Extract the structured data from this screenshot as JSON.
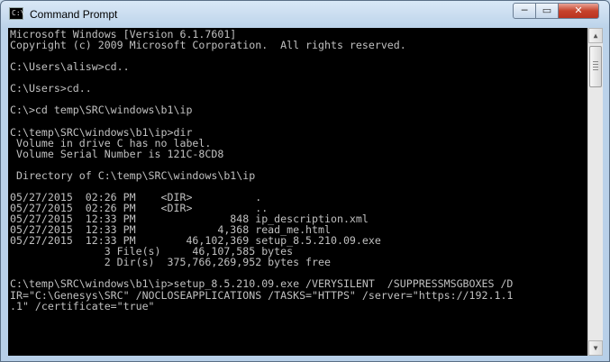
{
  "window": {
    "title": "Command Prompt",
    "app_icon_glyph": "C:\\",
    "controls": {
      "minimize": "─",
      "maximize": "▭",
      "close": "✕"
    }
  },
  "console": {
    "lines": [
      "Microsoft Windows [Version 6.1.7601]",
      "Copyright (c) 2009 Microsoft Corporation.  All rights reserved.",
      "",
      "C:\\Users\\alisw>cd..",
      "",
      "C:\\Users>cd..",
      "",
      "C:\\>cd temp\\SRC\\windows\\b1\\ip",
      "",
      "C:\\temp\\SRC\\windows\\b1\\ip>dir",
      " Volume in drive C has no label.",
      " Volume Serial Number is 121C-8CD8",
      "",
      " Directory of C:\\temp\\SRC\\windows\\b1\\ip",
      "",
      "05/27/2015  02:26 PM    <DIR>          .",
      "05/27/2015  02:26 PM    <DIR>          ..",
      "05/27/2015  12:33 PM               848 ip_description.xml",
      "05/27/2015  12:33 PM             4,368 read_me.html",
      "05/27/2015  12:33 PM        46,102,369 setup_8.5.210.09.exe",
      "               3 File(s)     46,107,585 bytes",
      "               2 Dir(s)  375,766,269,952 bytes free",
      "",
      "C:\\temp\\SRC\\windows\\b1\\ip>setup_8.5.210.09.exe /VERYSILENT  /SUPPRESSMSGBOXES /D",
      "IR=\"C:\\Genesys\\SRC\" /NOCLOSEAPPLICATIONS /TASKS=\"HTTPS\" /server=\"https://192.1.1",
      ".1\" /certificate=\"true\""
    ]
  },
  "scrollbar": {
    "up": "▲",
    "down": "▼"
  },
  "colors": {
    "console_bg": "#000000",
    "console_fg": "#c0c0c0",
    "close_button": "#c7432c"
  }
}
